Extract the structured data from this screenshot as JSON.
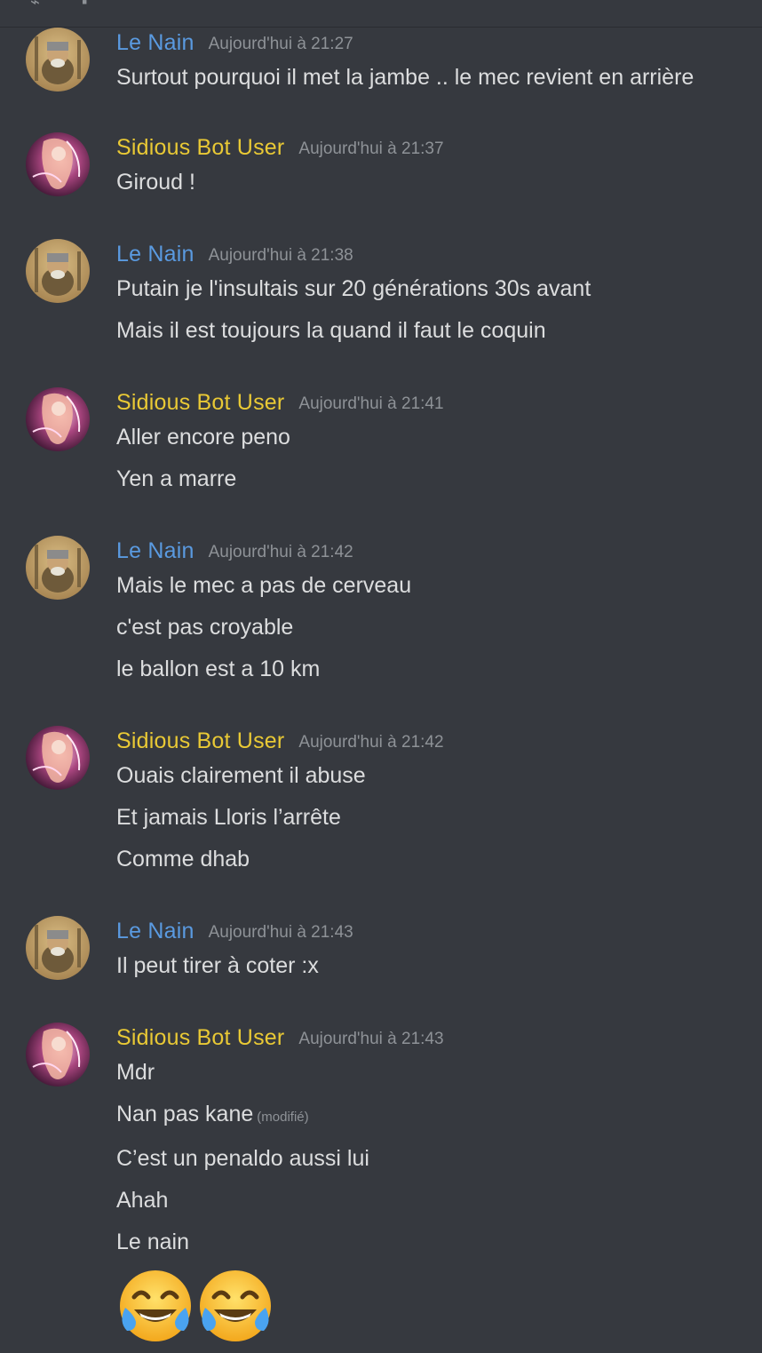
{
  "colors": {
    "background": "#36393f",
    "author_nain": "#5a9ae0",
    "author_sidious": "#e9c935",
    "text": "#dcddde",
    "timestamp": "#8e9297"
  },
  "messages": [
    {
      "author": "Le Nain",
      "timestamp": "Aujourd'hui à 21:27",
      "lines": [
        "Surtout pourquoi il met la jambe .. le mec revient en arrière"
      ]
    },
    {
      "author": "Sidious Bot User",
      "timestamp": "Aujourd'hui à 21:37",
      "lines": [
        "Giroud !"
      ]
    },
    {
      "author": "Le Nain",
      "timestamp": "Aujourd'hui à 21:38",
      "lines": [
        "Putain je l'insultais sur 20 générations 30s avant",
        "Mais il est toujours la quand il faut le coquin"
      ]
    },
    {
      "author": "Sidious Bot User",
      "timestamp": "Aujourd'hui à 21:41",
      "lines": [
        "Aller encore peno",
        "Yen a marre"
      ]
    },
    {
      "author": "Le Nain",
      "timestamp": "Aujourd'hui à 21:42",
      "lines": [
        "Mais le mec a pas de cerveau",
        "c'est pas croyable",
        "le ballon est a 10 km"
      ]
    },
    {
      "author": "Sidious Bot User",
      "timestamp": "Aujourd'hui à 21:42",
      "lines": [
        "Ouais clairement il abuse",
        "Et jamais Lloris l’arrête",
        "Comme dhab"
      ]
    },
    {
      "author": "Le Nain",
      "timestamp": "Aujourd'hui à 21:43",
      "lines": [
        "Il peut tirer à coter :x"
      ]
    },
    {
      "author": "Sidious Bot User",
      "timestamp": "Aujourd'hui à 21:43",
      "lines": [
        "Mdr",
        "Nan pas kane",
        "C’est un penaldo aussi lui",
        "Ahah",
        "Le nain"
      ],
      "edited_label": "(modifié)",
      "emojis": [
        "face-with-tears-of-joy",
        "face-with-tears-of-joy"
      ]
    }
  ]
}
